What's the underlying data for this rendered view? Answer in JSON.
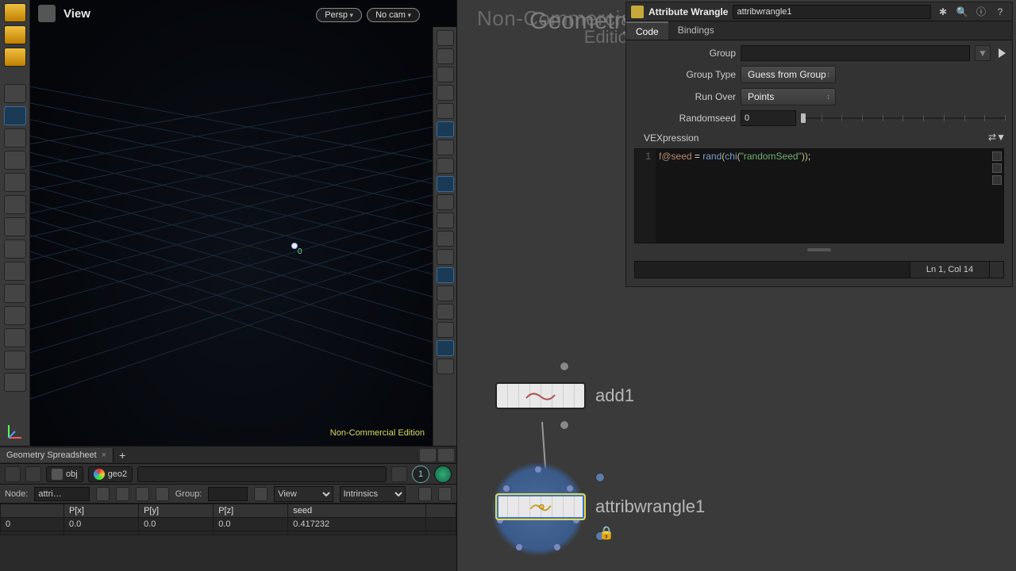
{
  "viewport": {
    "title": "View",
    "camera_menu": "Persp",
    "cam_select": "No cam",
    "watermark": "Non-Commercial Edition",
    "point_label": "0"
  },
  "spreadsheet": {
    "tab": "Geometry Spreadsheet",
    "path": {
      "level1": "obj",
      "level2": "geo2"
    },
    "pin_badge": "1",
    "node_label": "Node:",
    "node_value": "attri…",
    "group_label": "Group:",
    "view_label": "View",
    "intrinsics_label": "Intrinsics",
    "columns": [
      "",
      "P[x]",
      "P[y]",
      "P[z]",
      "seed"
    ],
    "rows": [
      {
        "idx": "0",
        "px": "0.0",
        "py": "0.0",
        "pz": "0.0",
        "seed": "0.417232"
      }
    ]
  },
  "watermark_block": {
    "line1": "Non-Commercial",
    "line2": "Edition",
    "geo": "Geometry"
  },
  "params": {
    "op_type": "Attribute Wrangle",
    "op_name": "attribwrangle1",
    "tabs": {
      "code": "Code",
      "bindings": "Bindings"
    },
    "group": {
      "label": "Group",
      "value": ""
    },
    "grouptype": {
      "label": "Group Type",
      "value": "Guess from Group"
    },
    "runover": {
      "label": "Run Over",
      "value": "Points"
    },
    "randomseed": {
      "label": "Randomseed",
      "value": "0"
    },
    "vex_label": "VEXpression",
    "vex_tokens": {
      "attr": "f@seed",
      "eq": " = ",
      "f1": "rand",
      "p1": "(",
      "f2": "chi",
      "p2": "(",
      "str": "\"randomSeed\"",
      "p3": ")",
      "p4": ")",
      "semi": ";"
    },
    "status_pos": "Ln 1, Col 14"
  },
  "network": {
    "node1": "add1",
    "node2": "attribwrangle1"
  }
}
